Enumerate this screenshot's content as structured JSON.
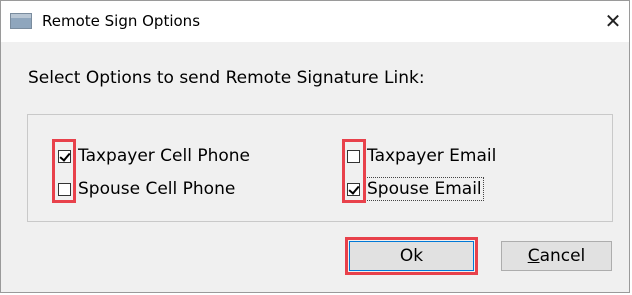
{
  "window": {
    "title": "Remote Sign Options",
    "close_glyph": "✕"
  },
  "dialog": {
    "instruction": "Select Options to send Remote Signature Link:"
  },
  "options": [
    {
      "label": "Taxpayer Cell Phone",
      "checked": true,
      "highlighted": true
    },
    {
      "label": "Spouse Cell Phone",
      "checked": false,
      "highlighted": true
    },
    {
      "label": "Taxpayer Email",
      "checked": false,
      "highlighted": true
    },
    {
      "label": "Spouse Email",
      "checked": true,
      "highlighted": true,
      "focused": true
    }
  ],
  "buttons": {
    "ok_label": "Ok",
    "cancel_accel": "C",
    "cancel_rest": "ancel"
  },
  "colors": {
    "highlight": "#e8414b",
    "dialog_bg": "#f0f0f0",
    "button_bg": "#e1e1e1"
  },
  "icons": {
    "app": "window-app-icon",
    "close": "close-icon"
  }
}
